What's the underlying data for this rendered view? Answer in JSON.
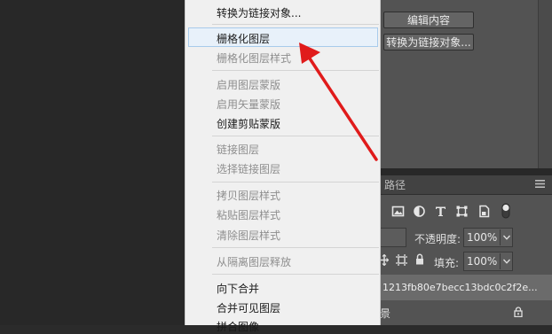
{
  "context_menu": {
    "items": [
      {
        "label": "转换为链接对象...",
        "enabled": true
      },
      {
        "label": "栅格化图层",
        "enabled": true,
        "highlighted": true
      },
      {
        "label": "栅格化图层样式",
        "enabled": false
      },
      {
        "label": "启用图层蒙版",
        "enabled": false
      },
      {
        "label": "启用矢量蒙版",
        "enabled": false
      },
      {
        "label": "创建剪贴蒙版",
        "enabled": true
      },
      {
        "label": "链接图层",
        "enabled": false
      },
      {
        "label": "选择链接图层",
        "enabled": false
      },
      {
        "label": "拷贝图层样式",
        "enabled": false
      },
      {
        "label": "粘贴图层样式",
        "enabled": false
      },
      {
        "label": "清除图层样式",
        "enabled": false
      },
      {
        "label": "从隔离图层释放",
        "enabled": false
      },
      {
        "label": "向下合并",
        "enabled": true
      },
      {
        "label": "合并可见图层",
        "enabled": true
      },
      {
        "label": "拼合图像",
        "enabled": true
      }
    ]
  },
  "properties": {
    "edit_contents_button": "编辑内容",
    "convert_linked_button": "转换为链接对象..."
  },
  "layers_panel": {
    "tab_label": "路径",
    "opacity_label": "不透明度:",
    "opacity_value": "100%",
    "fill_label": "填充:",
    "fill_value": "100%",
    "selected_layer_name": "1213fb80e7becc13bdc0c2f2e...",
    "background_layer_name": "景"
  },
  "colors": {
    "menu_bg": "#f0f0f0",
    "panel_bg": "#535353",
    "arrow": "#e01b1b",
    "highlight": "#e8f1fa"
  }
}
